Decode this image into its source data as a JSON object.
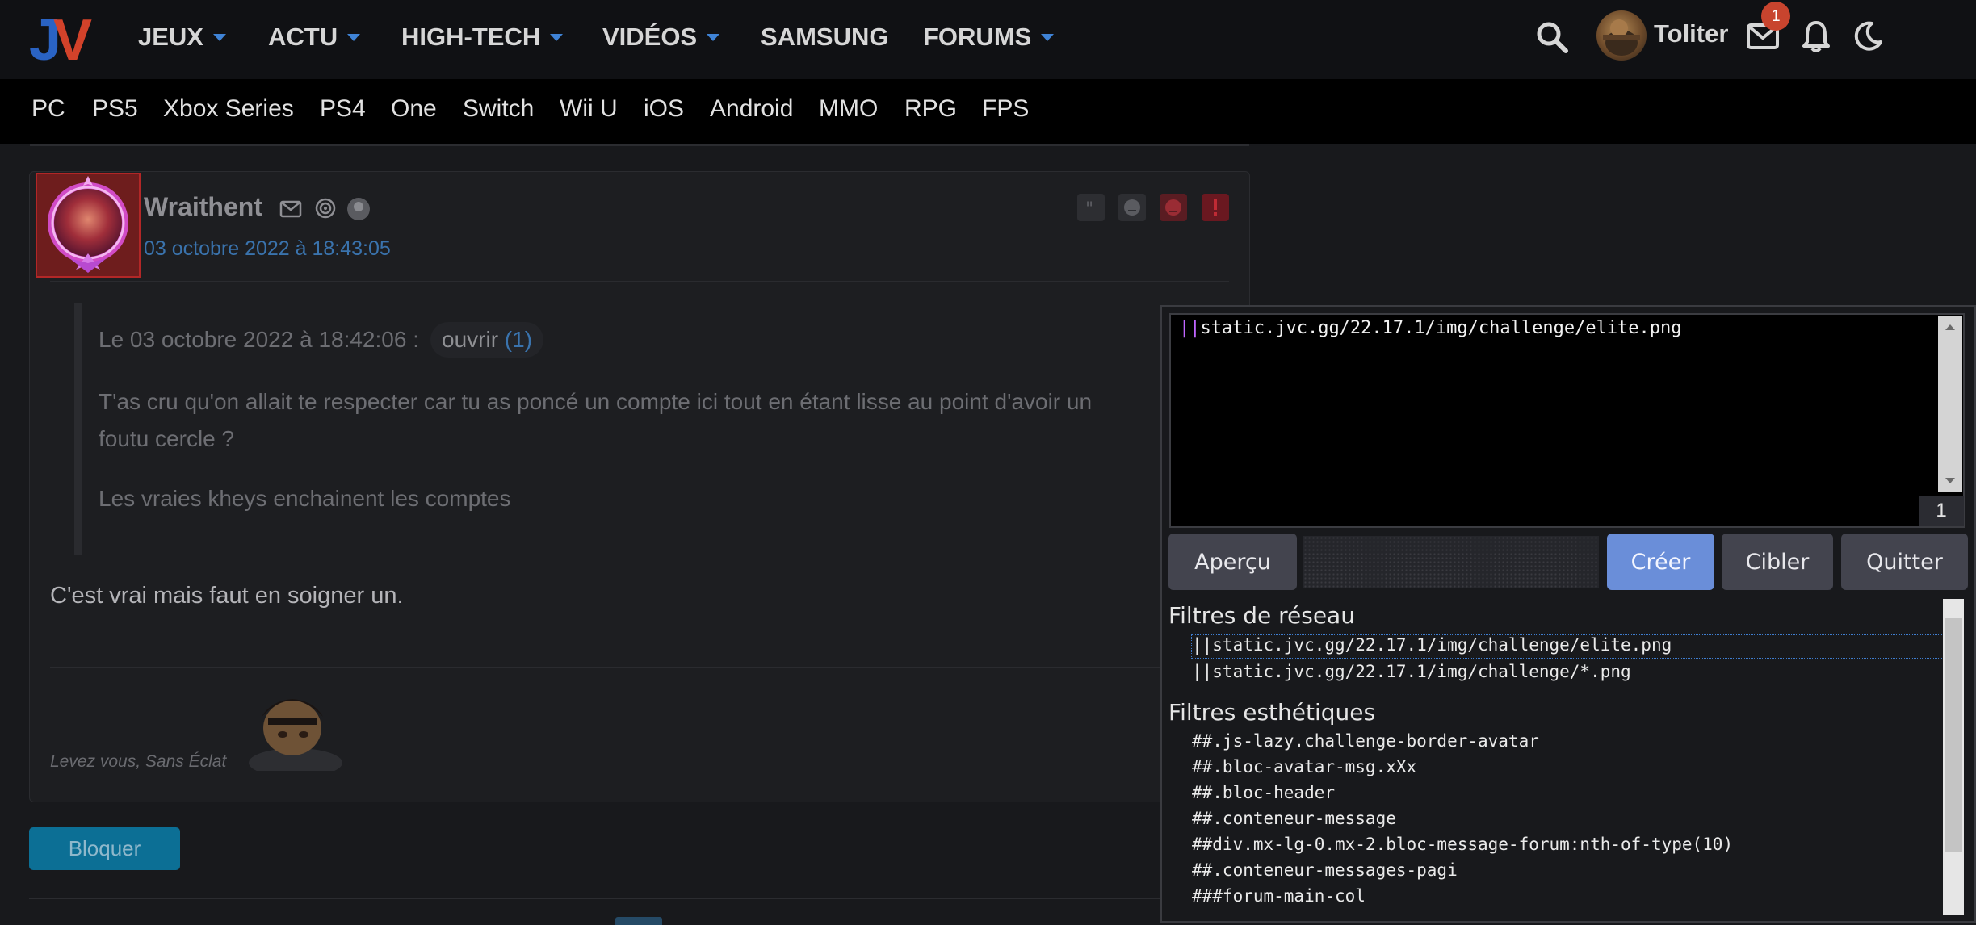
{
  "top_nav": {
    "logo_text": "JV",
    "items": [
      {
        "label": "JEUX",
        "dropdown": true
      },
      {
        "label": "ACTU",
        "dropdown": true
      },
      {
        "label": "HIGH-TECH",
        "dropdown": true
      },
      {
        "label": "VIDÉOS",
        "dropdown": true
      },
      {
        "label": "SAMSUNG",
        "dropdown": false
      },
      {
        "label": "FORUMS",
        "dropdown": true
      }
    ],
    "username": "Toliter",
    "messages_badge": "1",
    "icons": [
      "search-icon",
      "mail-icon",
      "bell-icon",
      "moon-icon"
    ]
  },
  "sub_nav": {
    "items": [
      "PC",
      "PS5",
      "Xbox Series",
      "PS4",
      "One",
      "Switch",
      "Wii U",
      "iOS",
      "Android",
      "MMO",
      "RPG",
      "FPS"
    ]
  },
  "post": {
    "author": "Wraithent",
    "date": "03 octobre 2022 à 18:43:05",
    "quote": {
      "header": "Le 03 octobre 2022 à 18:42:06 :",
      "open_label": "ouvrir",
      "open_count": "(1)",
      "line1": "T'as cru qu'on allait te respecter car tu as poncé un compte ici tout en étant lisse au point d'avoir un",
      "line2": "foutu cercle ?",
      "line3": "Les vraies kheys enchainent les comptes"
    },
    "reply": "C'est vrai mais faut en soigner un.",
    "signature": "Levez vous, Sans Éclat",
    "block_button": "Bloquer"
  },
  "picker": {
    "editor_prefix": "||",
    "editor_value": "static.jvc.gg/22.17.1/img/challenge/elite.png",
    "counter": "1",
    "buttons": {
      "preview": "Aperçu",
      "create": "Créer",
      "target": "Cibler",
      "quit": "Quitter"
    },
    "network_title": "Filtres de réseau",
    "network_filters": [
      "||static.jvc.gg/22.17.1/img/challenge/elite.png",
      "||static.jvc.gg/22.17.1/img/challenge/*.png"
    ],
    "cosmetic_title": "Filtres esthétiques",
    "cosmetic_filters": [
      "##.js-lazy.challenge-border-avatar",
      "##.bloc-avatar-msg.xXx",
      "##.bloc-header",
      "##.conteneur-message",
      "##div.mx-lg-0.mx-2.bloc-message-forum:nth-of-type(10)",
      "##.conteneur-messages-pagi",
      "###forum-main-col"
    ]
  },
  "colors": {
    "accent_blue": "#3f83d6",
    "create_button": "#6a8ed9",
    "block_button": "#0c6f95",
    "badge": "#c8442e"
  }
}
